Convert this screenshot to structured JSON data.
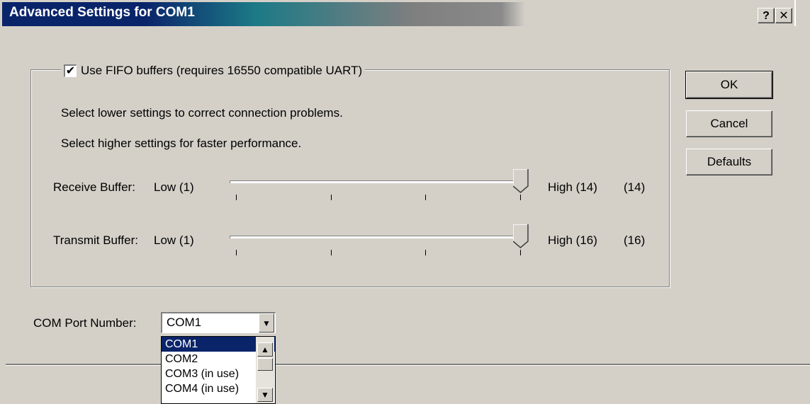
{
  "window": {
    "title": "Advanced Settings for COM1",
    "help_button": "?",
    "close_button": "✕"
  },
  "fifo": {
    "checked": true,
    "checkmark": "✔",
    "label": "Use FIFO buffers (requires 16550 compatible UART)"
  },
  "hints": [
    "Select lower settings to correct connection problems.",
    "Select higher settings for faster performance."
  ],
  "receive_buffer": {
    "label": "Receive Buffer:",
    "low": "Low (1)",
    "high": "High (14)",
    "value": "(14)",
    "level_fraction": 1.0
  },
  "transmit_buffer": {
    "label": "Transmit Buffer:",
    "low": "Low (1)",
    "high": "High (16)",
    "value": "(16)",
    "level_fraction": 1.0
  },
  "buttons": {
    "ok": "OK",
    "cancel": "Cancel",
    "defaults": "Defaults"
  },
  "com_port": {
    "label": "COM Port Number:",
    "selected": "COM1",
    "options": [
      "COM1",
      "COM2",
      "COM3 (in use)",
      "COM4 (in use)"
    ]
  },
  "colors": {
    "title_active": "#0a246a",
    "selection": "#0a246a",
    "face": "#d4d0c8"
  }
}
